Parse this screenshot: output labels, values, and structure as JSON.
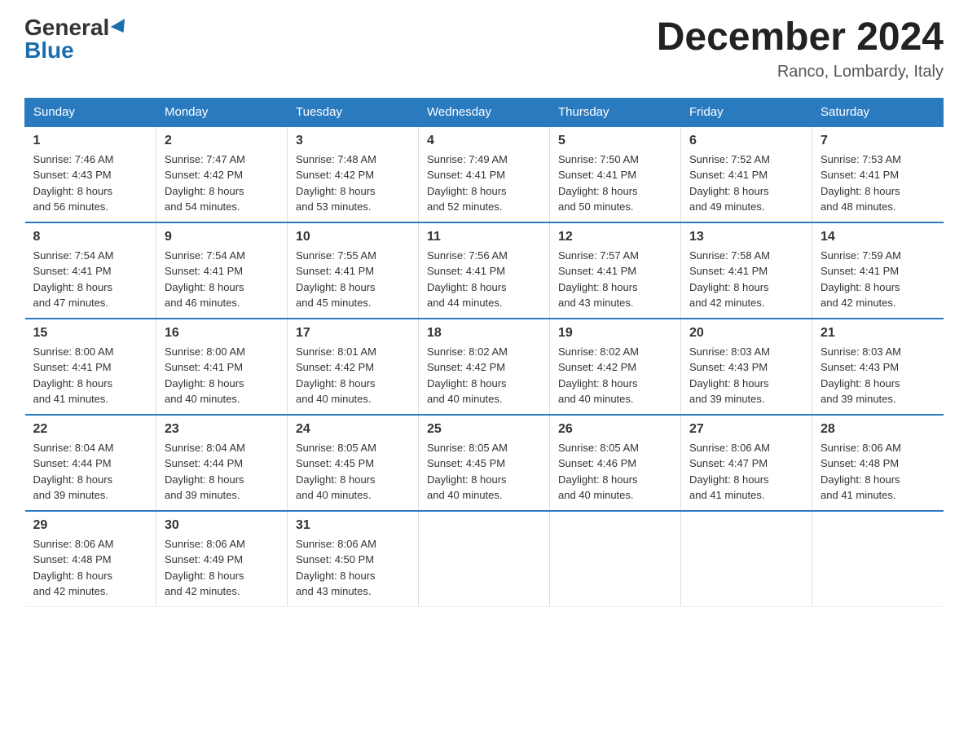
{
  "logo": {
    "general": "General",
    "blue": "Blue"
  },
  "title": "December 2024",
  "location": "Ranco, Lombardy, Italy",
  "days_of_week": [
    "Sunday",
    "Monday",
    "Tuesday",
    "Wednesday",
    "Thursday",
    "Friday",
    "Saturday"
  ],
  "weeks": [
    [
      {
        "day": "1",
        "sunrise": "7:46 AM",
        "sunset": "4:43 PM",
        "daylight": "8 hours and 56 minutes."
      },
      {
        "day": "2",
        "sunrise": "7:47 AM",
        "sunset": "4:42 PM",
        "daylight": "8 hours and 54 minutes."
      },
      {
        "day": "3",
        "sunrise": "7:48 AM",
        "sunset": "4:42 PM",
        "daylight": "8 hours and 53 minutes."
      },
      {
        "day": "4",
        "sunrise": "7:49 AM",
        "sunset": "4:41 PM",
        "daylight": "8 hours and 52 minutes."
      },
      {
        "day": "5",
        "sunrise": "7:50 AM",
        "sunset": "4:41 PM",
        "daylight": "8 hours and 50 minutes."
      },
      {
        "day": "6",
        "sunrise": "7:52 AM",
        "sunset": "4:41 PM",
        "daylight": "8 hours and 49 minutes."
      },
      {
        "day": "7",
        "sunrise": "7:53 AM",
        "sunset": "4:41 PM",
        "daylight": "8 hours and 48 minutes."
      }
    ],
    [
      {
        "day": "8",
        "sunrise": "7:54 AM",
        "sunset": "4:41 PM",
        "daylight": "8 hours and 47 minutes."
      },
      {
        "day": "9",
        "sunrise": "7:54 AM",
        "sunset": "4:41 PM",
        "daylight": "8 hours and 46 minutes."
      },
      {
        "day": "10",
        "sunrise": "7:55 AM",
        "sunset": "4:41 PM",
        "daylight": "8 hours and 45 minutes."
      },
      {
        "day": "11",
        "sunrise": "7:56 AM",
        "sunset": "4:41 PM",
        "daylight": "8 hours and 44 minutes."
      },
      {
        "day": "12",
        "sunrise": "7:57 AM",
        "sunset": "4:41 PM",
        "daylight": "8 hours and 43 minutes."
      },
      {
        "day": "13",
        "sunrise": "7:58 AM",
        "sunset": "4:41 PM",
        "daylight": "8 hours and 42 minutes."
      },
      {
        "day": "14",
        "sunrise": "7:59 AM",
        "sunset": "4:41 PM",
        "daylight": "8 hours and 42 minutes."
      }
    ],
    [
      {
        "day": "15",
        "sunrise": "8:00 AM",
        "sunset": "4:41 PM",
        "daylight": "8 hours and 41 minutes."
      },
      {
        "day": "16",
        "sunrise": "8:00 AM",
        "sunset": "4:41 PM",
        "daylight": "8 hours and 40 minutes."
      },
      {
        "day": "17",
        "sunrise": "8:01 AM",
        "sunset": "4:42 PM",
        "daylight": "8 hours and 40 minutes."
      },
      {
        "day": "18",
        "sunrise": "8:02 AM",
        "sunset": "4:42 PM",
        "daylight": "8 hours and 40 minutes."
      },
      {
        "day": "19",
        "sunrise": "8:02 AM",
        "sunset": "4:42 PM",
        "daylight": "8 hours and 40 minutes."
      },
      {
        "day": "20",
        "sunrise": "8:03 AM",
        "sunset": "4:43 PM",
        "daylight": "8 hours and 39 minutes."
      },
      {
        "day": "21",
        "sunrise": "8:03 AM",
        "sunset": "4:43 PM",
        "daylight": "8 hours and 39 minutes."
      }
    ],
    [
      {
        "day": "22",
        "sunrise": "8:04 AM",
        "sunset": "4:44 PM",
        "daylight": "8 hours and 39 minutes."
      },
      {
        "day": "23",
        "sunrise": "8:04 AM",
        "sunset": "4:44 PM",
        "daylight": "8 hours and 39 minutes."
      },
      {
        "day": "24",
        "sunrise": "8:05 AM",
        "sunset": "4:45 PM",
        "daylight": "8 hours and 40 minutes."
      },
      {
        "day": "25",
        "sunrise": "8:05 AM",
        "sunset": "4:45 PM",
        "daylight": "8 hours and 40 minutes."
      },
      {
        "day": "26",
        "sunrise": "8:05 AM",
        "sunset": "4:46 PM",
        "daylight": "8 hours and 40 minutes."
      },
      {
        "day": "27",
        "sunrise": "8:06 AM",
        "sunset": "4:47 PM",
        "daylight": "8 hours and 41 minutes."
      },
      {
        "day": "28",
        "sunrise": "8:06 AM",
        "sunset": "4:48 PM",
        "daylight": "8 hours and 41 minutes."
      }
    ],
    [
      {
        "day": "29",
        "sunrise": "8:06 AM",
        "sunset": "4:48 PM",
        "daylight": "8 hours and 42 minutes."
      },
      {
        "day": "30",
        "sunrise": "8:06 AM",
        "sunset": "4:49 PM",
        "daylight": "8 hours and 42 minutes."
      },
      {
        "day": "31",
        "sunrise": "8:06 AM",
        "sunset": "4:50 PM",
        "daylight": "8 hours and 43 minutes."
      },
      null,
      null,
      null,
      null
    ]
  ],
  "labels": {
    "sunrise": "Sunrise:",
    "sunset": "Sunset:",
    "daylight": "Daylight:"
  }
}
